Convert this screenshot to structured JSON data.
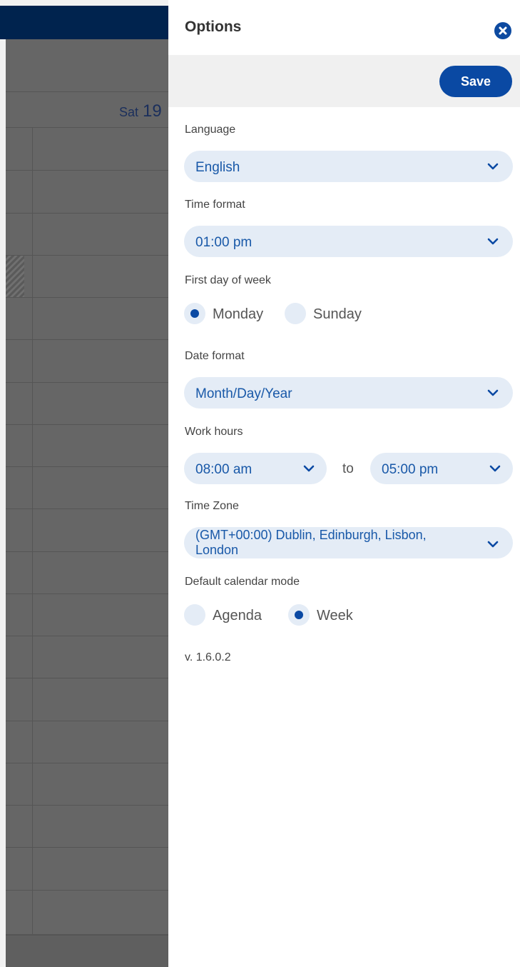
{
  "calendar": {
    "day_name": "Sat",
    "day_number": "19"
  },
  "options": {
    "title": "Options",
    "save_label": "Save",
    "language": {
      "label": "Language",
      "value": "English"
    },
    "time_format": {
      "label": "Time format",
      "value": "01:00 pm"
    },
    "first_day": {
      "label": "First day of week",
      "options": [
        "Monday",
        "Sunday"
      ],
      "selected": "Monday"
    },
    "date_format": {
      "label": "Date format",
      "value": "Month/Day/Year"
    },
    "work_hours": {
      "label": "Work hours",
      "start": "08:00 am",
      "separator": "to",
      "end": "05:00 pm"
    },
    "time_zone": {
      "label": "Time Zone",
      "value": "(GMT+00:00) Dublin, Edinburgh, Lisbon, London"
    },
    "calendar_mode": {
      "label": "Default calendar mode",
      "options": [
        "Agenda",
        "Week"
      ],
      "selected": "Week"
    },
    "version": "v. 1.6.0.2"
  },
  "colors": {
    "accent": "#0a49a3",
    "select_bg": "#e4ecf6",
    "header_bar": "#00234e",
    "overlay": "#666666"
  }
}
